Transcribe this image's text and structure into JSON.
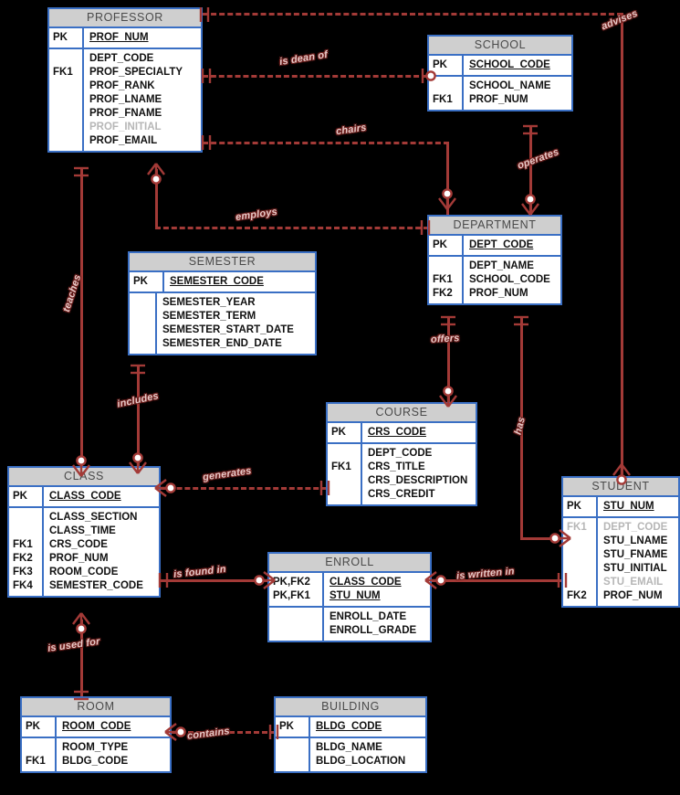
{
  "diagram": {
    "title": "University Database Crow's Foot ERD",
    "colors": {
      "entity_border": "#3a6fc4",
      "entity_header_bg": "#cfcfcf",
      "relationship_line": "#a33a37",
      "canvas_bg": "#000000",
      "dim_text": "#b6b6b6"
    }
  },
  "entities": [
    {
      "name": "PROFESSOR",
      "pk_keys": [
        "PK"
      ],
      "pk_attrs": [
        "PROF_NUM"
      ],
      "fk_keys": [
        "FK1"
      ],
      "attrs": [
        {
          "text": "DEPT_CODE",
          "dim": false
        },
        {
          "text": "PROF_SPECIALTY",
          "dim": false
        },
        {
          "text": "PROF_RANK",
          "dim": false
        },
        {
          "text": "PROF_LNAME",
          "dim": false
        },
        {
          "text": "PROF_FNAME",
          "dim": false
        },
        {
          "text": "PROF_INITIAL",
          "dim": true
        },
        {
          "text": "PROF_EMAIL",
          "dim": false
        }
      ]
    },
    {
      "name": "SCHOOL",
      "pk_keys": [
        "PK"
      ],
      "pk_attrs": [
        "SCHOOL_CODE"
      ],
      "fk_keys": [
        "FK1"
      ],
      "attrs": [
        {
          "text": "SCHOOL_NAME",
          "dim": false
        },
        {
          "text": "PROF_NUM",
          "dim": false
        }
      ]
    },
    {
      "name": "DEPARTMENT",
      "pk_keys": [
        "PK"
      ],
      "pk_attrs": [
        "DEPT_CODE"
      ],
      "fk_keys": [
        "FK1",
        "FK2"
      ],
      "attrs": [
        {
          "text": "DEPT_NAME",
          "dim": false
        },
        {
          "text": "SCHOOL_CODE",
          "dim": false
        },
        {
          "text": "PROF_NUM",
          "dim": false
        }
      ]
    },
    {
      "name": "SEMESTER",
      "pk_keys": [
        "PK"
      ],
      "pk_attrs": [
        "SEMESTER_CODE"
      ],
      "fk_keys": [],
      "attrs": [
        {
          "text": "SEMESTER_YEAR",
          "dim": false
        },
        {
          "text": "SEMESTER_TERM",
          "dim": false
        },
        {
          "text": "SEMESTER_START_DATE",
          "dim": false
        },
        {
          "text": "SEMESTER_END_DATE",
          "dim": false
        }
      ]
    },
    {
      "name": "COURSE",
      "pk_keys": [
        "PK"
      ],
      "pk_attrs": [
        "CRS_CODE"
      ],
      "fk_keys": [
        "FK1"
      ],
      "attrs": [
        {
          "text": "DEPT_CODE",
          "dim": false
        },
        {
          "text": "CRS_TITLE",
          "dim": false
        },
        {
          "text": "CRS_DESCRIPTION",
          "dim": false
        },
        {
          "text": "CRS_CREDIT",
          "dim": false
        }
      ]
    },
    {
      "name": "CLASS",
      "pk_keys": [
        "PK"
      ],
      "pk_attrs": [
        "CLASS_CODE"
      ],
      "fk_keys": [
        "FK1",
        "FK2",
        "FK3",
        "FK4"
      ],
      "attrs": [
        {
          "text": "CLASS_SECTION",
          "dim": false
        },
        {
          "text": "CLASS_TIME",
          "dim": false
        },
        {
          "text": "CRS_CODE",
          "dim": false
        },
        {
          "text": "PROF_NUM",
          "dim": false
        },
        {
          "text": "ROOM_CODE",
          "dim": false
        },
        {
          "text": "SEMESTER_CODE",
          "dim": false
        }
      ]
    },
    {
      "name": "ENROLL",
      "pk_keys": [
        "PK,FK2",
        "PK,FK1"
      ],
      "pk_attrs": [
        "CLASS_CODE",
        "STU_NUM"
      ],
      "fk_keys": [],
      "attrs": [
        {
          "text": "ENROLL_DATE",
          "dim": false
        },
        {
          "text": "ENROLL_GRADE",
          "dim": false
        }
      ]
    },
    {
      "name": "STUDENT",
      "pk_keys": [
        "PK"
      ],
      "pk_attrs": [
        "STU_NUM"
      ],
      "fk_keys": [
        "FK1",
        "FK2"
      ],
      "attrs": [
        {
          "text": "DEPT_CODE",
          "dim": true
        },
        {
          "text": "STU_LNAME",
          "dim": false
        },
        {
          "text": "STU_FNAME",
          "dim": false
        },
        {
          "text": "STU_INITIAL",
          "dim": false
        },
        {
          "text": "STU_EMAIL",
          "dim": true
        },
        {
          "text": "PROF_NUM",
          "dim": false
        }
      ]
    },
    {
      "name": "ROOM",
      "pk_keys": [
        "PK"
      ],
      "pk_attrs": [
        "ROOM_CODE"
      ],
      "fk_keys": [
        "FK1"
      ],
      "attrs": [
        {
          "text": "ROOM_TYPE",
          "dim": false
        },
        {
          "text": "BLDG_CODE",
          "dim": false
        }
      ]
    },
    {
      "name": "BUILDING",
      "pk_keys": [
        "PK"
      ],
      "pk_attrs": [
        "BLDG_CODE"
      ],
      "fk_keys": [],
      "attrs": [
        {
          "text": "BLDG_NAME",
          "dim": false
        },
        {
          "text": "BLDG_LOCATION",
          "dim": false
        }
      ]
    }
  ],
  "relationships": [
    {
      "label": "advises",
      "from": "PROFESSOR",
      "to": "STUDENT"
    },
    {
      "label": "is dean of",
      "from": "PROFESSOR",
      "to": "SCHOOL"
    },
    {
      "label": "chairs",
      "from": "PROFESSOR",
      "to": "DEPARTMENT"
    },
    {
      "label": "operates",
      "from": "SCHOOL",
      "to": "DEPARTMENT"
    },
    {
      "label": "employs",
      "from": "DEPARTMENT",
      "to": "PROFESSOR"
    },
    {
      "label": "teaches",
      "from": "PROFESSOR",
      "to": "CLASS"
    },
    {
      "label": "offers",
      "from": "DEPARTMENT",
      "to": "COURSE"
    },
    {
      "label": "has",
      "from": "DEPARTMENT",
      "to": "STUDENT"
    },
    {
      "label": "includes",
      "from": "SEMESTER",
      "to": "CLASS"
    },
    {
      "label": "generates",
      "from": "COURSE",
      "to": "CLASS"
    },
    {
      "label": "is found in",
      "from": "CLASS",
      "to": "ENROLL"
    },
    {
      "label": "is written in",
      "from": "ENROLL",
      "to": "STUDENT"
    },
    {
      "label": "is used for",
      "from": "ROOM",
      "to": "CLASS"
    },
    {
      "label": "contains",
      "from": "BUILDING",
      "to": "ROOM"
    }
  ]
}
